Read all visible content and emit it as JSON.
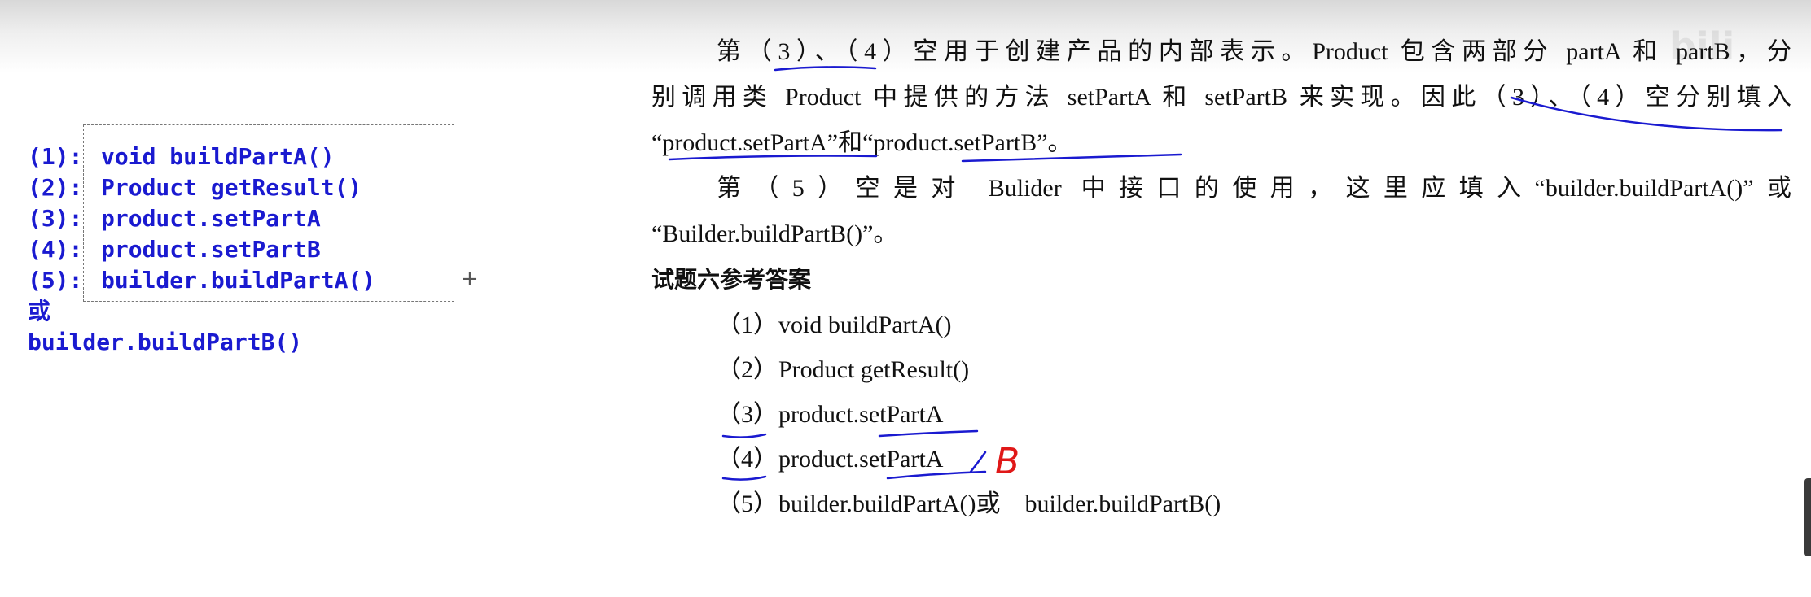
{
  "code_panel": {
    "lines": [
      {
        "num": "(1):",
        "text": "void buildPartA()"
      },
      {
        "num": "(2):",
        "text": "Product getResult()"
      },
      {
        "num": "(3):",
        "text": "product.setPartA"
      },
      {
        "num": "(4):",
        "text": "product.setPartB"
      },
      {
        "num": "(5):",
        "text": "builder.buildPartA()"
      }
    ],
    "or": "或",
    "alt": "builder.buildPartB()",
    "plus": "+"
  },
  "document": {
    "para1_line1": "第（3）、（4）空用于创建产品的内部表示。Product 包含两部分 partA 和 partB，分",
    "para1_line2": "别调用类 Product 中提供的方法 setPartA 和 setPartB 来实现。因此（3）、（4）空分别填入",
    "para1_line3": "“product.setPartA”和“product.setPartB”。",
    "para2_line1": "第（5）空是对 Bulider 中接口的使用，这里应填入“builder.buildPartA()”或",
    "para2_line2": "“Builder.buildPartB()”。",
    "heading": "试题六参考答案",
    "answers": [
      {
        "num": "（1）",
        "text": "void buildPartA()"
      },
      {
        "num": "（2）",
        "text": "Product getResult()"
      },
      {
        "num": "（3）",
        "text": "product.setPartA"
      },
      {
        "num": "（4）",
        "text": "product.setPartA"
      },
      {
        "num": "（5）",
        "text": "builder.buildPartA()或    builder.buildPartB()"
      }
    ]
  },
  "annotations": {
    "handwritten_correction": "B",
    "ink_color": "#1a1ad0",
    "correction_color": "#e01818"
  },
  "colors": {
    "code_text": "#1a1ad0",
    "doc_text": "#111111"
  }
}
